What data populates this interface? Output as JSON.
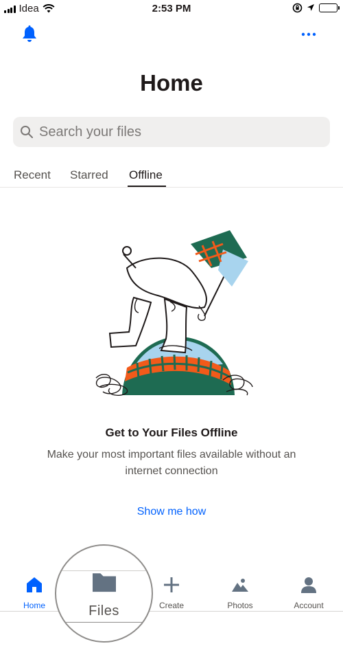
{
  "status_bar": {
    "carrier": "Idea",
    "time": "2:53 PM"
  },
  "header": {
    "title": "Home"
  },
  "search": {
    "placeholder": "Search your files"
  },
  "tabs": [
    {
      "label": "Recent",
      "active": false
    },
    {
      "label": "Starred",
      "active": false
    },
    {
      "label": "Offline",
      "active": true
    }
  ],
  "empty_state": {
    "title": "Get to Your Files Offline",
    "description": "Make your most important files available without an internet connection",
    "link": "Show me how"
  },
  "nav": [
    {
      "label": "Home",
      "icon": "home-icon",
      "active": true
    },
    {
      "label": "Files",
      "icon": "folder-icon",
      "active": false
    },
    {
      "label": "Create",
      "icon": "plus-icon",
      "active": false
    },
    {
      "label": "Photos",
      "icon": "photos-icon",
      "active": false
    },
    {
      "label": "Account",
      "icon": "person-icon",
      "active": false
    }
  ],
  "colors": {
    "accent": "#0061fe",
    "text": "#1e1919",
    "muted": "#55524f",
    "icon_gray": "#637282"
  }
}
